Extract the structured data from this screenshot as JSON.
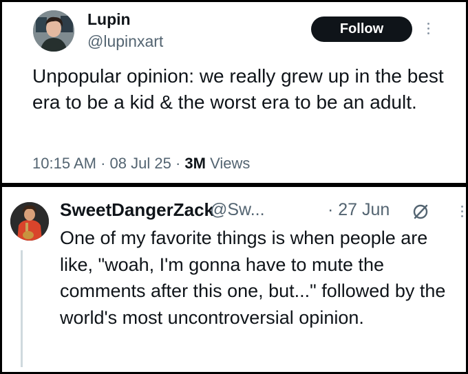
{
  "tweet": {
    "author_name": "Lupin",
    "author_handle": "@lupinxart",
    "follow_label": "Follow",
    "text": "Unpopular opinion: we really grew up in the best era to be a kid & the worst era to be an adult.",
    "time": "10:15 AM",
    "date": "08 Jul 25",
    "views_count": "3M",
    "views_label": "Views",
    "separator": "·"
  },
  "reply": {
    "author_name": "SweetDangerZack",
    "author_handle": "@Sw...",
    "date": "· 27 Jun",
    "text": "One of my favorite things is when people are like, \"woah, I'm gonna have to mute the comments after this one, but...\" followed by the world's most uncontroversial opinion."
  },
  "icons": {
    "more": "more-options-icon",
    "edited": "clock-slash-icon"
  },
  "colors": {
    "text": "#0f1419",
    "secondary": "#536471",
    "button": "#0f1419",
    "divider": "#000000"
  }
}
